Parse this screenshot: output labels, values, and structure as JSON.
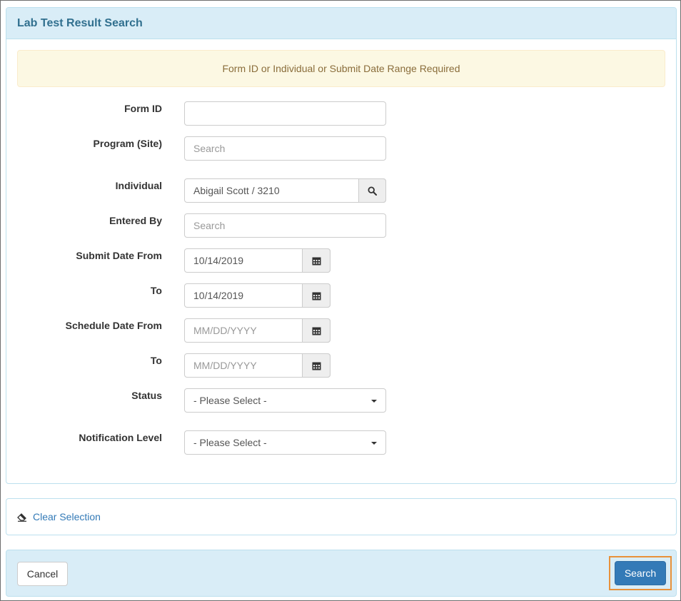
{
  "panel": {
    "title": "Lab Test Result Search",
    "alert": "Form ID or Individual or Submit Date Range Required"
  },
  "form": {
    "form_id": {
      "label": "Form ID",
      "value": ""
    },
    "program": {
      "label": "Program (Site)",
      "placeholder": "Search"
    },
    "individual": {
      "label": "Individual",
      "value": "Abigail Scott / 3210",
      "icon": "search-icon"
    },
    "entered_by": {
      "label": "Entered By",
      "placeholder": "Search"
    },
    "submit_from": {
      "label": "Submit Date From",
      "value": "10/14/2019",
      "icon": "calendar-icon"
    },
    "submit_to": {
      "label": "To",
      "value": "10/14/2019",
      "icon": "calendar-icon"
    },
    "schedule_from": {
      "label": "Schedule Date From",
      "placeholder": "MM/DD/YYYY",
      "icon": "calendar-icon"
    },
    "schedule_to": {
      "label": "To",
      "placeholder": "MM/DD/YYYY",
      "icon": "calendar-icon"
    },
    "status": {
      "label": "Status",
      "selected": "- Please Select -"
    },
    "notification": {
      "label": "Notification Level",
      "selected": "- Please Select -"
    }
  },
  "clear": {
    "label": "Clear Selection",
    "icon": "eraser-icon"
  },
  "footer": {
    "cancel_label": "Cancel",
    "search_label": "Search"
  },
  "colors": {
    "primary": "#337ab7",
    "panel_heading": "#d9edf7",
    "alert_bg": "#fcf8e3",
    "focus": "#e8913a"
  }
}
